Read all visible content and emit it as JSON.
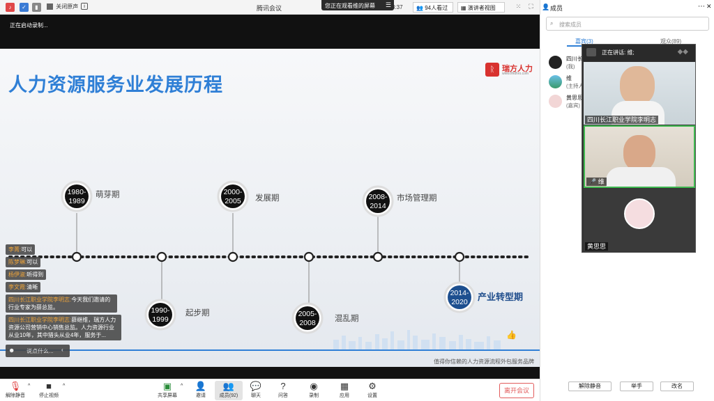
{
  "topbar": {
    "mute_label": "关闭原声",
    "title": "腾讯会议",
    "share_banner": "您正在观看维的屏幕",
    "timer": "8:37",
    "viewers": "94人看过",
    "view_mode": "演讲者视图"
  },
  "recording": {
    "status": "正在启动录制..."
  },
  "slide": {
    "title": "人力资源服务业发展历程",
    "brand_name": "瑞方人力",
    "brand_url": "www.fihdhro.com",
    "tagline": "值得你信赖的人力资源流程外包服务品牌",
    "stages_top": [
      {
        "years_a": "1980-",
        "years_b": "1989",
        "label": "萌芽期"
      },
      {
        "years_a": "2000-",
        "years_b": "2005",
        "label": "发展期"
      },
      {
        "years_a": "2008-",
        "years_b": "2014",
        "label": "市场管理期"
      }
    ],
    "stages_bottom": [
      {
        "years_a": "1990-",
        "years_b": "1999",
        "label": "起步期"
      },
      {
        "years_a": "2005-",
        "years_b": "2008",
        "label": "混乱期"
      },
      {
        "years_a": "2014-",
        "years_b": "2020",
        "label": "产业转型期"
      }
    ]
  },
  "chat": {
    "messages": [
      {
        "who": "李菁:",
        "text": "可以"
      },
      {
        "who": "陈梦琳:",
        "text": "可以"
      },
      {
        "who": "杨伊淑:",
        "text": "听得到"
      },
      {
        "who": "李文霞:",
        "text": "清晰"
      },
      {
        "who": "四川长江职业学院李明志:",
        "text": "今天我们邀请的行业专家为薛总监。"
      },
      {
        "who": "四川长江职业学院李明志:",
        "text": "薛继维，瑞方人力资源公司营销中心销售总监。人力资源行业从业10年，其中猎头从业4年，服务于..."
      }
    ],
    "input_placeholder": "说点什么..."
  },
  "toolbar": {
    "unmute": "解除静音",
    "stop_video": "停止视频",
    "share_screen": "共享屏幕",
    "invite": "邀请",
    "members": "成员(92)",
    "chat": "聊天",
    "qa": "问答",
    "record": "录制",
    "apps": "应用",
    "settings": "设置",
    "leave": "离开会议"
  },
  "panel": {
    "title": "成员",
    "search_placeholder": "搜索成员",
    "tab_guests": "嘉宾(3)",
    "tab_audience": "观众(89)",
    "members": [
      {
        "name": "四川长...",
        "role": "(我)"
      },
      {
        "name": "维",
        "role": "(主持人..."
      },
      {
        "name": "黄思思",
        "role": "(嘉宾)"
      }
    ],
    "unmute_all": "解除静音",
    "raise_hand": "举手",
    "rename": "改名"
  },
  "speaker_overlay": {
    "speaking": "正在讲话: 维;",
    "tiles": [
      {
        "name": "四川长江职业学院李明志"
      },
      {
        "name": "维"
      },
      {
        "name": "黄思思"
      }
    ]
  }
}
